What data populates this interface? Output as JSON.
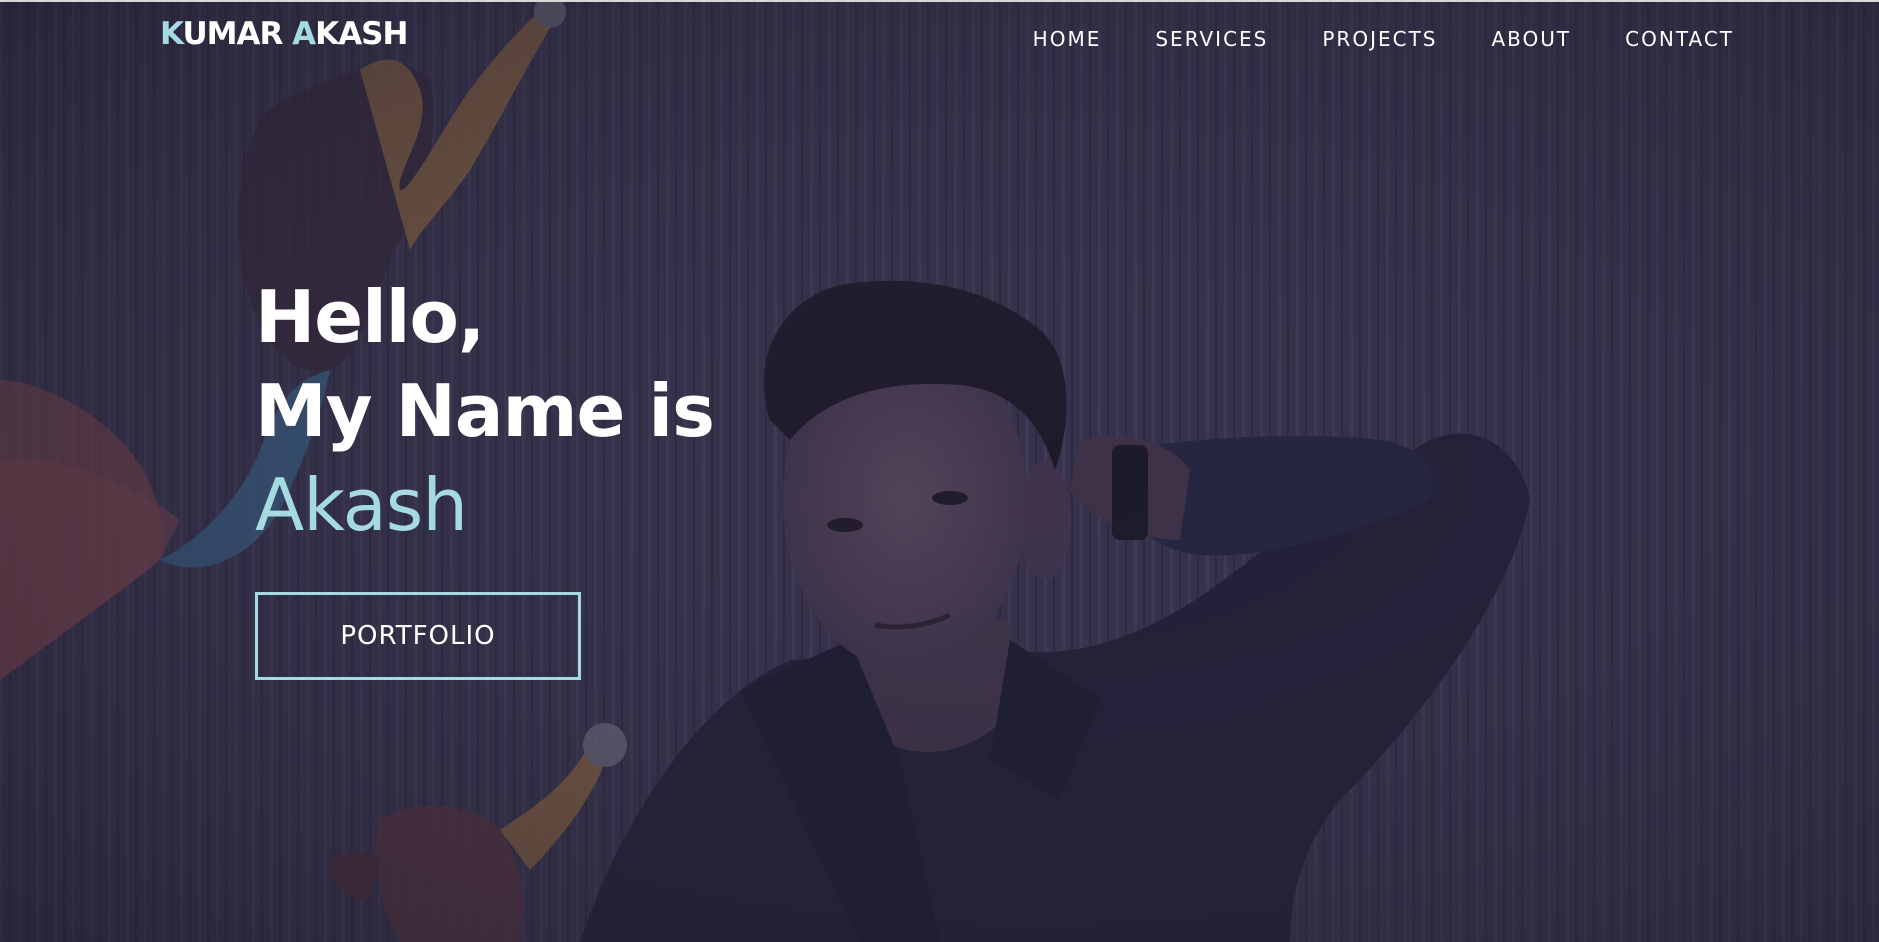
{
  "brand": {
    "first_initial": "K",
    "first_rest": "UMAR ",
    "last_initial": "A",
    "last_rest": "KASH"
  },
  "nav": {
    "items": [
      {
        "label": "HOME"
      },
      {
        "label": "SERVICES"
      },
      {
        "label": "PROJECTS"
      },
      {
        "label": "ABOUT"
      },
      {
        "label": "CONTACT"
      }
    ]
  },
  "hero": {
    "line1": "Hello,",
    "line2": "My Name is",
    "name": "Akash",
    "cta_label": "PORTFOLIO"
  },
  "colors": {
    "accent": "#a5dbe0",
    "text": "#ffffff",
    "overlay": "#2e2a3d"
  }
}
